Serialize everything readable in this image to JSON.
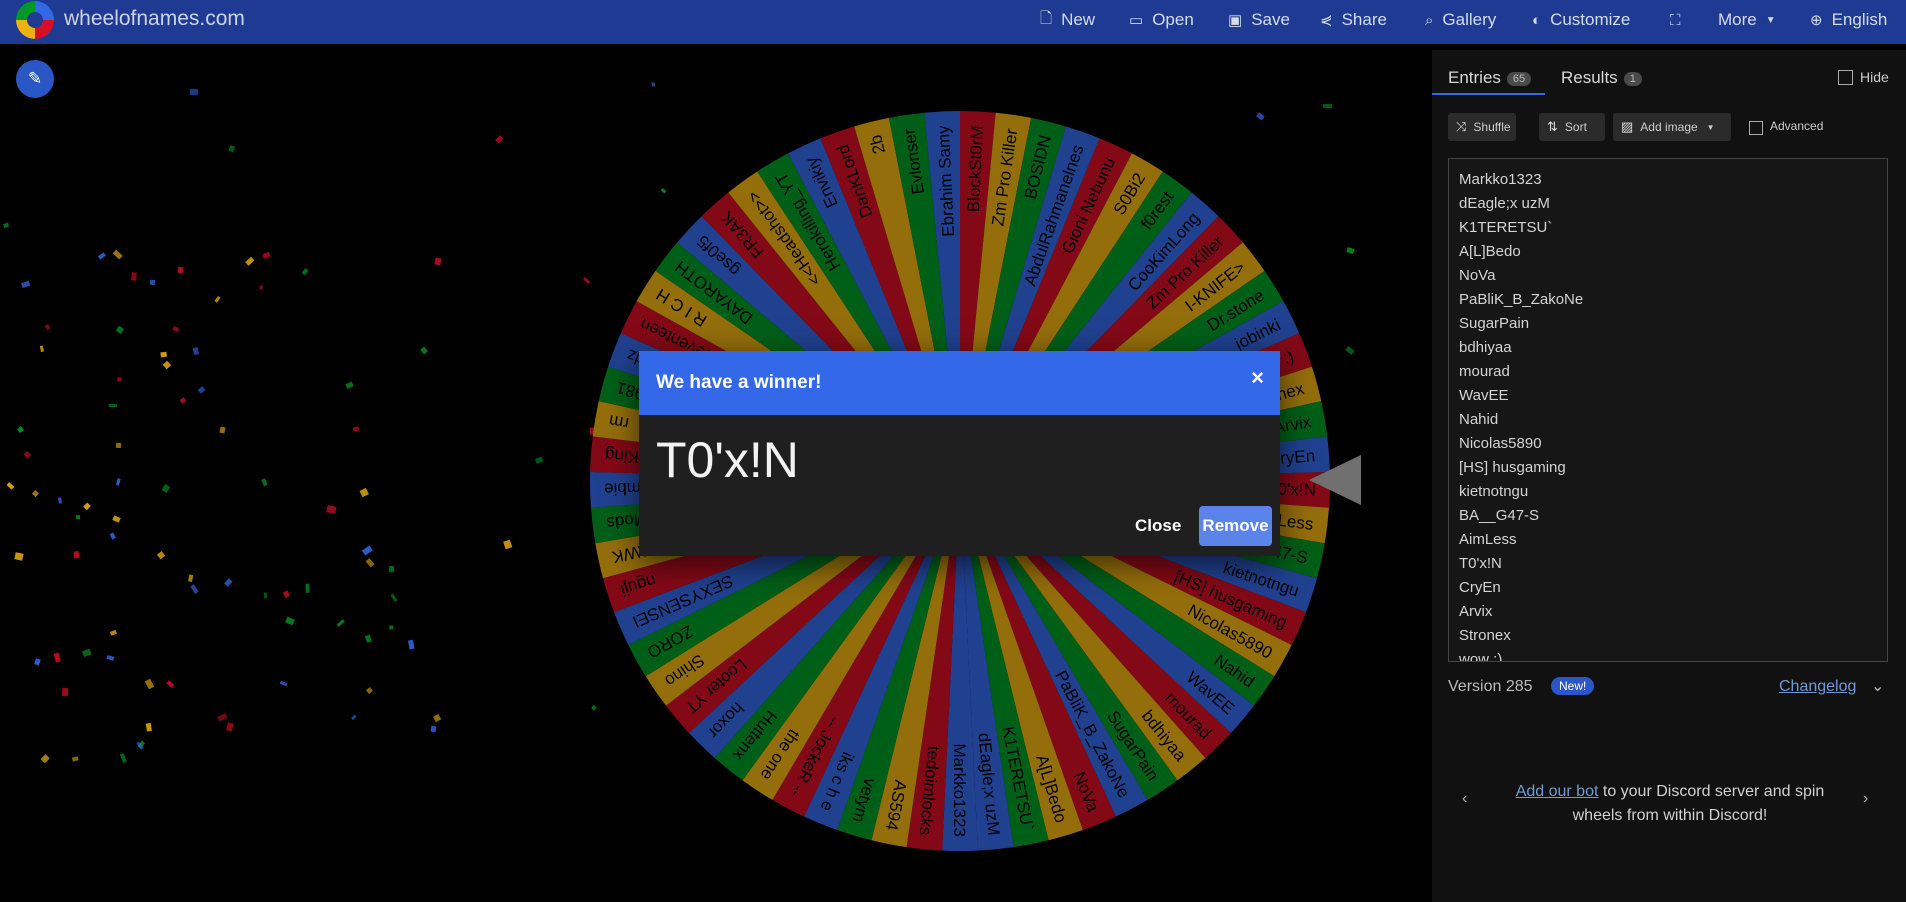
{
  "header": {
    "site_title": "wheelofnames.com",
    "nav": [
      {
        "label": "New",
        "icon": "file-icon"
      },
      {
        "label": "Open",
        "icon": "folder-icon"
      },
      {
        "label": "Save",
        "icon": "save-icon"
      },
      {
        "label": "Share",
        "icon": "share-icon"
      },
      {
        "label": "Gallery",
        "icon": "search-icon"
      },
      {
        "label": "Customize",
        "icon": "palette-icon"
      },
      {
        "label": "",
        "icon": "fullscreen-icon"
      },
      {
        "label": "More",
        "icon": "chevron-down-icon"
      },
      {
        "label": "English",
        "icon": "globe-icon"
      }
    ]
  },
  "colors": {
    "topbar": "#1f3a93",
    "blue": "#3369e8",
    "red": "#d50f25",
    "yellow": "#eeb211",
    "green": "#009925"
  },
  "dialog": {
    "title": "We have a winner!",
    "close_x": "×",
    "winner": "T0'x!N",
    "close_label": "Close",
    "remove_label": "Remove"
  },
  "sidebar": {
    "tabs": [
      {
        "label": "Entries",
        "count": "65"
      },
      {
        "label": "Results",
        "count": "1"
      }
    ],
    "hide_label": "Hide",
    "tools": [
      {
        "label": "Shuffle",
        "icon": "shuffle-icon"
      },
      {
        "label": "Sort",
        "icon": "sort-icon"
      },
      {
        "label": "Add image",
        "icon": "image-icon"
      }
    ],
    "advanced_label": "Advanced",
    "entries": [
      "Markko1323",
      "dEagle;x uzM",
      "K1TERETSU`",
      "A[L]Bedo",
      "NoVa",
      "PaBliK_B_ZakoNe",
      "SugarPain",
      "bdhiyaa",
      "mourad",
      "WavEE",
      "Nahid",
      "Nicolas5890",
      "[HS] husgaming",
      "kietnotngu",
      "BA__G47-S",
      "AimLess",
      "T0'x!N",
      "CryEn",
      "Arvix",
      "Stronex",
      "wow :)"
    ],
    "version": "Version 285",
    "new_badge": "New!",
    "changelog": "Changelog",
    "discord_link": "Add our bot",
    "discord_text": " to your Discord server and spin wheels from within Discord!"
  },
  "wheel": {
    "segment_colors": [
      "#3369e8",
      "#d50f25",
      "#eeb211",
      "#009925"
    ],
    "segments": [
      "Markko1323",
      "tedoimlocks",
      "AS594",
      "vetym",
      "iks c h e",
      "-- JockeR --",
      "the one",
      "Huttenx",
      "hoxor",
      "Looter YT",
      "Shino",
      "ZORO",
      "SEXYSENSEI",
      "nguji",
      "AWK",
      "Mods",
      "mbie",
      "King",
      "rm",
      "1981",
      "-dz",
      "seventeen",
      "R I C H",
      "DAYAROTH",
      "gse0f5",
      "FR3AK",
      "<<Headshot>>",
      "Herokilling_YT",
      "Envikiy",
      "DanKLord",
      "2b",
      "Evlonser",
      "Ebrahim Samy",
      "BlockSt0rM",
      "Zm Pro Killer",
      "BOSIDN",
      "AbdulRahmanelnes",
      "Gioni Nebunu",
      "S0Bi2",
      "f0rest",
      "CooKimLong",
      "Zm Pro Killer",
      "I-KNIFE>",
      "Dr.stone",
      "jobinki",
      "wow :)",
      "Stronex",
      "Arvix",
      "CryEn",
      "T0'x!N",
      "AimLess",
      "BA__G47-S",
      "kietnotngu",
      "[HS] husgaming",
      "Nicolas5890",
      "Nahid",
      "WavEE",
      "mourad",
      "bdhiyaa",
      "SugarPain",
      "PaBliK_B_ZakoNe",
      "NoVa",
      "A[L]Bedo",
      "K1TERETSU`",
      "dEagle;x uzM"
    ]
  }
}
